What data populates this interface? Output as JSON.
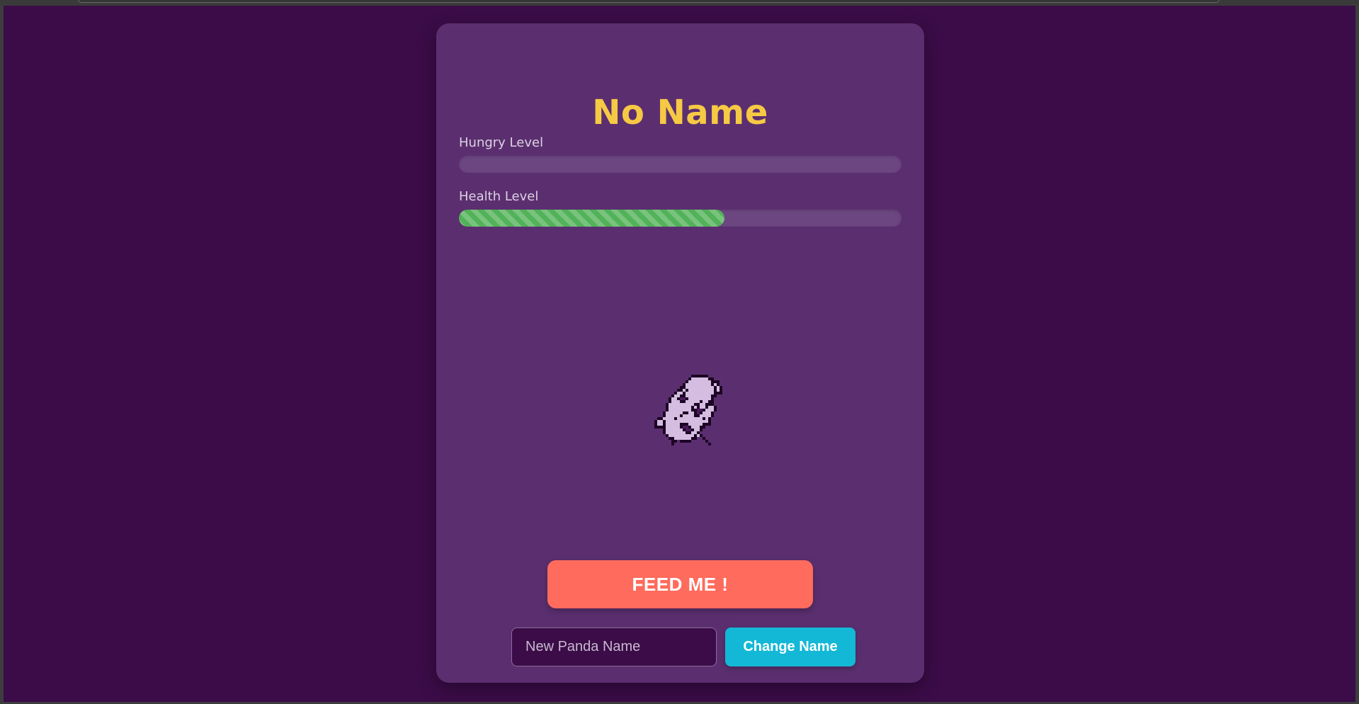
{
  "pet": {
    "name": "No Name"
  },
  "stats": {
    "hungry": {
      "label": "Hungry Level",
      "value_pct": 0
    },
    "health": {
      "label": "Health Level",
      "value_pct": 60
    }
  },
  "actions": {
    "feed_label": "FEED ME !",
    "rename_placeholder": "New Panda Name",
    "rename_value": "",
    "change_name_label": "Change Name"
  },
  "colors": {
    "page_background": "#3b0c48",
    "card_background": "#5b2f6f",
    "title": "#f6c944",
    "health_fill": "#52b259",
    "feed_button": "#ff6b5c",
    "change_name_button": "#13b8d6",
    "panda_body": "#d4bde0",
    "panda_outline": "#1c0524",
    "panda_eye": "#4a1a5c"
  },
  "icons": {
    "panda": "pixel-panda-sprite"
  }
}
